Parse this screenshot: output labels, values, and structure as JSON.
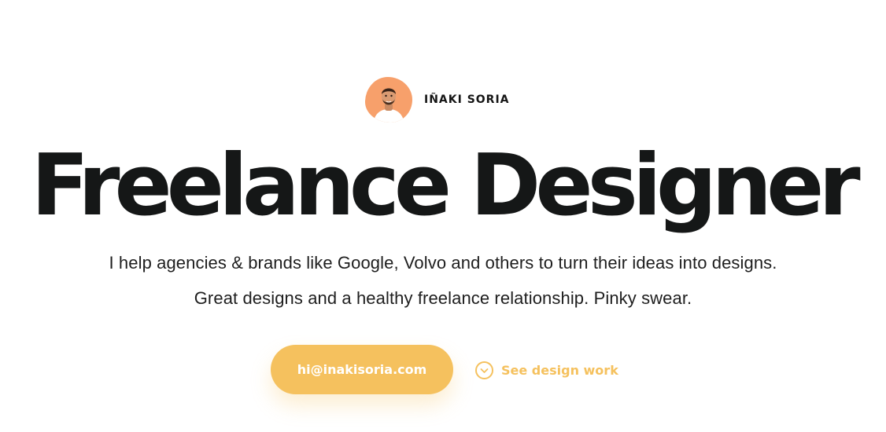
{
  "profile": {
    "name": "IÑAKI SORIA",
    "avatar_color": "#f7a06b"
  },
  "hero": {
    "headline": "Freelance Designer",
    "subtitle_line1": "I help agencies & brands like Google, Volvo and others to turn their ideas into designs.",
    "subtitle_line2": "Great designs and a healthy freelance relationship. Pinky swear."
  },
  "actions": {
    "email_button": "hi@inakisoria.com",
    "see_work_link": "See design work",
    "see_work_icon": "chevron-down-circle-icon",
    "accent_color": "#f5c15e"
  }
}
